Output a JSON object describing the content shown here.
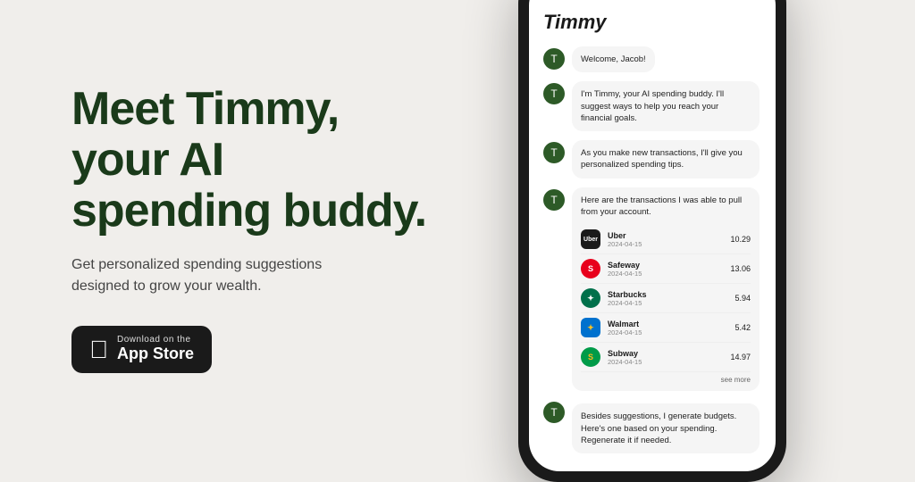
{
  "page": {
    "background": "#f0eeeb"
  },
  "left": {
    "headline": "Meet Timmy, your AI spending buddy.",
    "subtitle": "Get personalized spending suggestions designed to grow your wealth.",
    "appstore": {
      "download_on": "Download on the",
      "store_name": "App Store"
    }
  },
  "phone": {
    "app_title": "Timmy",
    "messages": [
      {
        "text": "Welcome, Jacob!"
      },
      {
        "text": "I'm Timmy, your AI spending buddy. I'll suggest ways to help you reach your financial goals."
      },
      {
        "text": "As you make new transactions, I'll give you personalized spending tips."
      },
      {
        "text": "Here are the transactions I was able to pull from your account."
      }
    ],
    "transactions": [
      {
        "name": "Uber",
        "date": "2024-04-15",
        "amount": "10.29",
        "logo": "uber",
        "symbol": "Uber"
      },
      {
        "name": "Safeway",
        "date": "2024-04-15",
        "amount": "13.06",
        "logo": "safeway",
        "symbol": "S"
      },
      {
        "name": "Starbucks",
        "date": "2024-04-15",
        "amount": "5.94",
        "logo": "starbucks",
        "symbol": "★"
      },
      {
        "name": "Walmart",
        "date": "2024-04-15",
        "amount": "5.42",
        "logo": "walmart",
        "symbol": "✦"
      },
      {
        "name": "Subway",
        "date": "2024-04-15",
        "amount": "14.97",
        "logo": "subway",
        "symbol": "S"
      }
    ],
    "see_more": "see more",
    "budget_message": "Besides suggestions, I generate budgets. Here's one based on your spending. Regenerate it if needed."
  }
}
